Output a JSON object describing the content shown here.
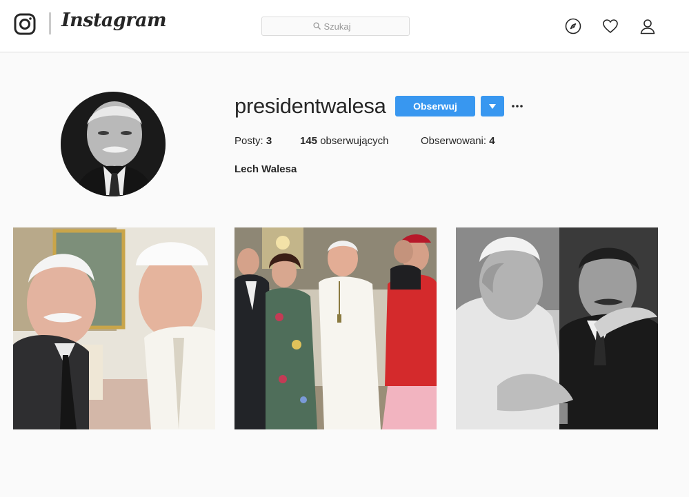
{
  "header": {
    "brand": "Instagram",
    "search": {
      "placeholder": "Szukaj"
    },
    "icons": [
      "instagram-camera-icon",
      "compass-icon",
      "heart-icon",
      "user-icon"
    ]
  },
  "profile": {
    "username": "presidentwalesa",
    "follow_label": "Obserwuj",
    "stats": {
      "posts_label": "Posty:",
      "posts_count": "3",
      "followers_count": "145",
      "followers_label": "obserwujących",
      "following_label": "Obserwowani:",
      "following_count": "4"
    },
    "full_name": "Lech Walesa"
  },
  "posts": [
    {
      "kind": "photo",
      "palette": [
        "#8a8f7f",
        "#f2f0ea",
        "#2b2b2b"
      ]
    },
    {
      "kind": "photo",
      "palette": [
        "#c9c3b4",
        "#f6f3ec",
        "#d23a2e"
      ]
    },
    {
      "kind": "photo",
      "palette": [
        "#bcbcbc",
        "#2a2a2a",
        "#e8e8e8"
      ]
    }
  ],
  "colors": {
    "accent": "#3897f0",
    "background": "#fafafa",
    "border": "#dbdbdb",
    "text": "#262626"
  }
}
